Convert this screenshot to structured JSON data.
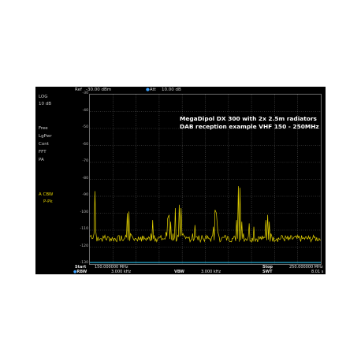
{
  "top_bar": {
    "ref_label": "Ref",
    "ref_value": "-30.00 dBm",
    "att_label": "Att",
    "att_value": "10.00 dB"
  },
  "left_panel": {
    "scale_type": "LOG",
    "scale_div": "10 dB",
    "trigger": "Free",
    "power_mode": "LgPwr",
    "sweep_mode": "Cont",
    "fft": "FFT",
    "pa": "PA",
    "trace_a": "A  CBW",
    "detector": "P-Pk"
  },
  "annotation": {
    "line1": "MegaDipol DX 300 with 2x 2.5m radiators",
    "line2": "DAB reception example VHF 150 - 250MHz"
  },
  "bottom_bar": {
    "start_label": "Start",
    "start_value": "150.000000 MHz",
    "stop_label": "Stop",
    "stop_value": "250.000000 MHz",
    "rbw_label": "RBW",
    "rbw_value": "3.000 kHz",
    "vbw_label": "VBW",
    "vbw_value": "3.000 kHz",
    "swt_label": "SWT",
    "swt_value": "8.01 s"
  },
  "colors": {
    "trace": "#e6d400",
    "accent": "#3da3ff"
  },
  "chart_data": {
    "type": "line",
    "xlabel": "",
    "ylabel": "",
    "x_unit": "MHz",
    "xlim": [
      150,
      250
    ],
    "ylim": [
      -130,
      -30
    ],
    "y_ticks": [
      -30,
      -40,
      -50,
      -60,
      -70,
      -80,
      -90,
      -100,
      -110,
      -120,
      -130
    ],
    "grid": true,
    "noise_floor": -115,
    "series": [
      {
        "values_x": [
          150,
          150.5,
          151.8,
          152.2,
          152.6,
          153.5,
          155.0,
          156.5,
          158.0,
          160.0,
          162.0,
          164.0,
          165.5,
          166.2,
          166.9,
          167.6,
          168.5,
          170.0,
          172.0,
          174.0,
          176.5,
          177.2,
          177.9,
          178.6,
          180.0,
          181.5,
          183.0,
          183.7,
          184.3,
          185.0,
          186.0,
          187.0,
          188.0,
          188.7,
          189.5,
          190.3,
          191.5,
          193.0,
          194.5,
          195.5,
          196.5,
          197.5,
          198.5,
          200.0,
          202.0,
          203.5,
          204.2,
          204.8,
          205.4,
          206.0,
          207.0,
          208.5,
          210.0,
          212.0,
          213.5,
          214.3,
          215.0,
          215.8,
          216.5,
          217.5,
          219.0,
          221.0,
          223.0,
          225.0,
          226.2,
          227.0,
          227.7,
          228.4,
          229.5,
          231.0,
          233.0,
          236.0,
          239.0,
          242.0,
          245.0,
          247.5,
          250.0
        ],
        "values_y": [
          -114,
          -113,
          -112,
          -87,
          -111,
          -114,
          -115,
          -113,
          -114,
          -115,
          -114,
          -116,
          -113,
          -100,
          -99,
          -112,
          -114,
          -115,
          -114,
          -115,
          -112,
          -104,
          -113,
          -115,
          -114,
          -115,
          -111,
          -103,
          -101,
          -105,
          -112,
          -97,
          -113,
          -95,
          -97,
          -112,
          -115,
          -114,
          -112,
          -107,
          -114,
          -115,
          -113,
          -114,
          -115,
          -108,
          -98,
          -100,
          -111,
          -114,
          -115,
          -113,
          -114,
          -115,
          -104,
          -84,
          -85,
          -105,
          -112,
          -115,
          -106,
          -108,
          -114,
          -115,
          -104,
          -101,
          -105,
          -112,
          -114,
          -115,
          -113,
          -116,
          -114,
          -115,
          -115,
          -114,
          -116
        ]
      }
    ]
  }
}
